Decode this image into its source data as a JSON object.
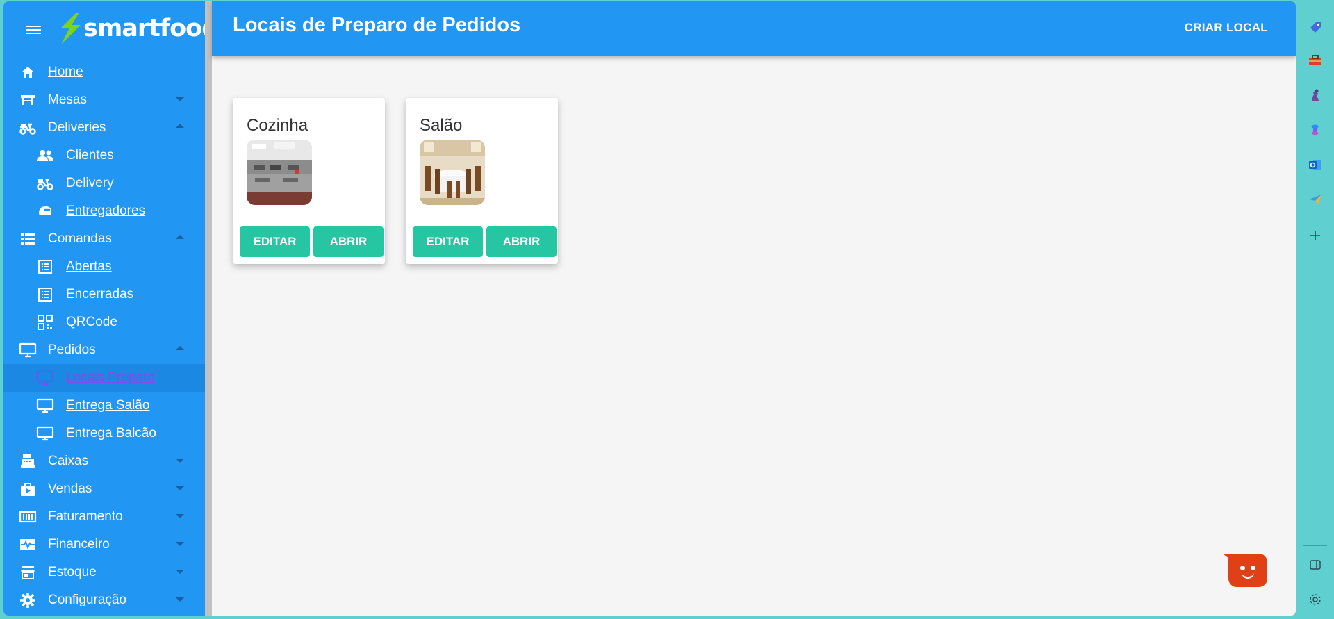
{
  "app": {
    "brand": "smartfood",
    "page_title": "Locais de Preparo de Pedidos",
    "create_button": "CRIAR LOCAL"
  },
  "sidebar": {
    "items": [
      {
        "label": "Home",
        "icon": "home-icon",
        "level": 0,
        "link": true
      },
      {
        "label": "Mesas",
        "icon": "table-icon",
        "level": 0,
        "caret": "down"
      },
      {
        "label": "Deliveries",
        "icon": "moped-icon",
        "level": 0,
        "caret": "up"
      },
      {
        "label": "Clientes",
        "icon": "people-icon",
        "level": 1,
        "link": true
      },
      {
        "label": "Delivery",
        "icon": "moped-icon",
        "level": 1,
        "link": true
      },
      {
        "label": "Entregadores",
        "icon": "helmet-icon",
        "level": 1,
        "link": true
      },
      {
        "label": "Comandas",
        "icon": "list-icon",
        "level": 0,
        "caret": "up"
      },
      {
        "label": "Abertas",
        "icon": "receipt-icon",
        "level": 1,
        "link": true
      },
      {
        "label": "Encerradas",
        "icon": "receipt-icon",
        "level": 1,
        "link": true
      },
      {
        "label": "QRCode",
        "icon": "qrcode-icon",
        "level": 1,
        "link": true
      },
      {
        "label": "Pedidos",
        "icon": "monitor-icon",
        "level": 0,
        "caret": "up"
      },
      {
        "label": "Locais Preparo",
        "icon": "monitor-icon",
        "level": 1,
        "link": true,
        "active": true
      },
      {
        "label": "Entrega Salão",
        "icon": "monitor-icon",
        "level": 1,
        "link": true
      },
      {
        "label": "Entrega Balcão",
        "icon": "monitor-icon",
        "level": 1,
        "link": true
      },
      {
        "label": "Caixas",
        "icon": "cash-register-icon",
        "level": 0,
        "caret": "down"
      },
      {
        "label": "Vendas",
        "icon": "play-bag-icon",
        "level": 0,
        "caret": "down"
      },
      {
        "label": "Faturamento",
        "icon": "counter-icon",
        "level": 0,
        "caret": "down"
      },
      {
        "label": "Financeiro",
        "icon": "pulse-icon",
        "level": 0,
        "caret": "down"
      },
      {
        "label": "Estoque",
        "icon": "store-icon",
        "level": 0,
        "caret": "down"
      },
      {
        "label": "Configuração",
        "icon": "gear-icon",
        "level": 0,
        "caret": "down"
      }
    ]
  },
  "cards": [
    {
      "title": "Cozinha",
      "image": "kitchen-photo",
      "edit_label": "EDITAR",
      "open_label": "ABRIR"
    },
    {
      "title": "Salão",
      "image": "dining-hall-photo",
      "edit_label": "EDITAR",
      "open_label": "ABRIR"
    }
  ],
  "edge_bar": {
    "icons": [
      "tag-icon",
      "toolbox-icon",
      "chess-icon",
      "copilot-icon",
      "outlook-icon",
      "send-icon",
      "add-icon",
      "sidepanel-icon",
      "settings-icon"
    ]
  },
  "colors": {
    "primary": "#2196f3",
    "accent_button": "#26c6a2",
    "active_item": "#7a4ef0",
    "chat_widget": "#e04016",
    "edge_bar": "#5fd0cf"
  }
}
